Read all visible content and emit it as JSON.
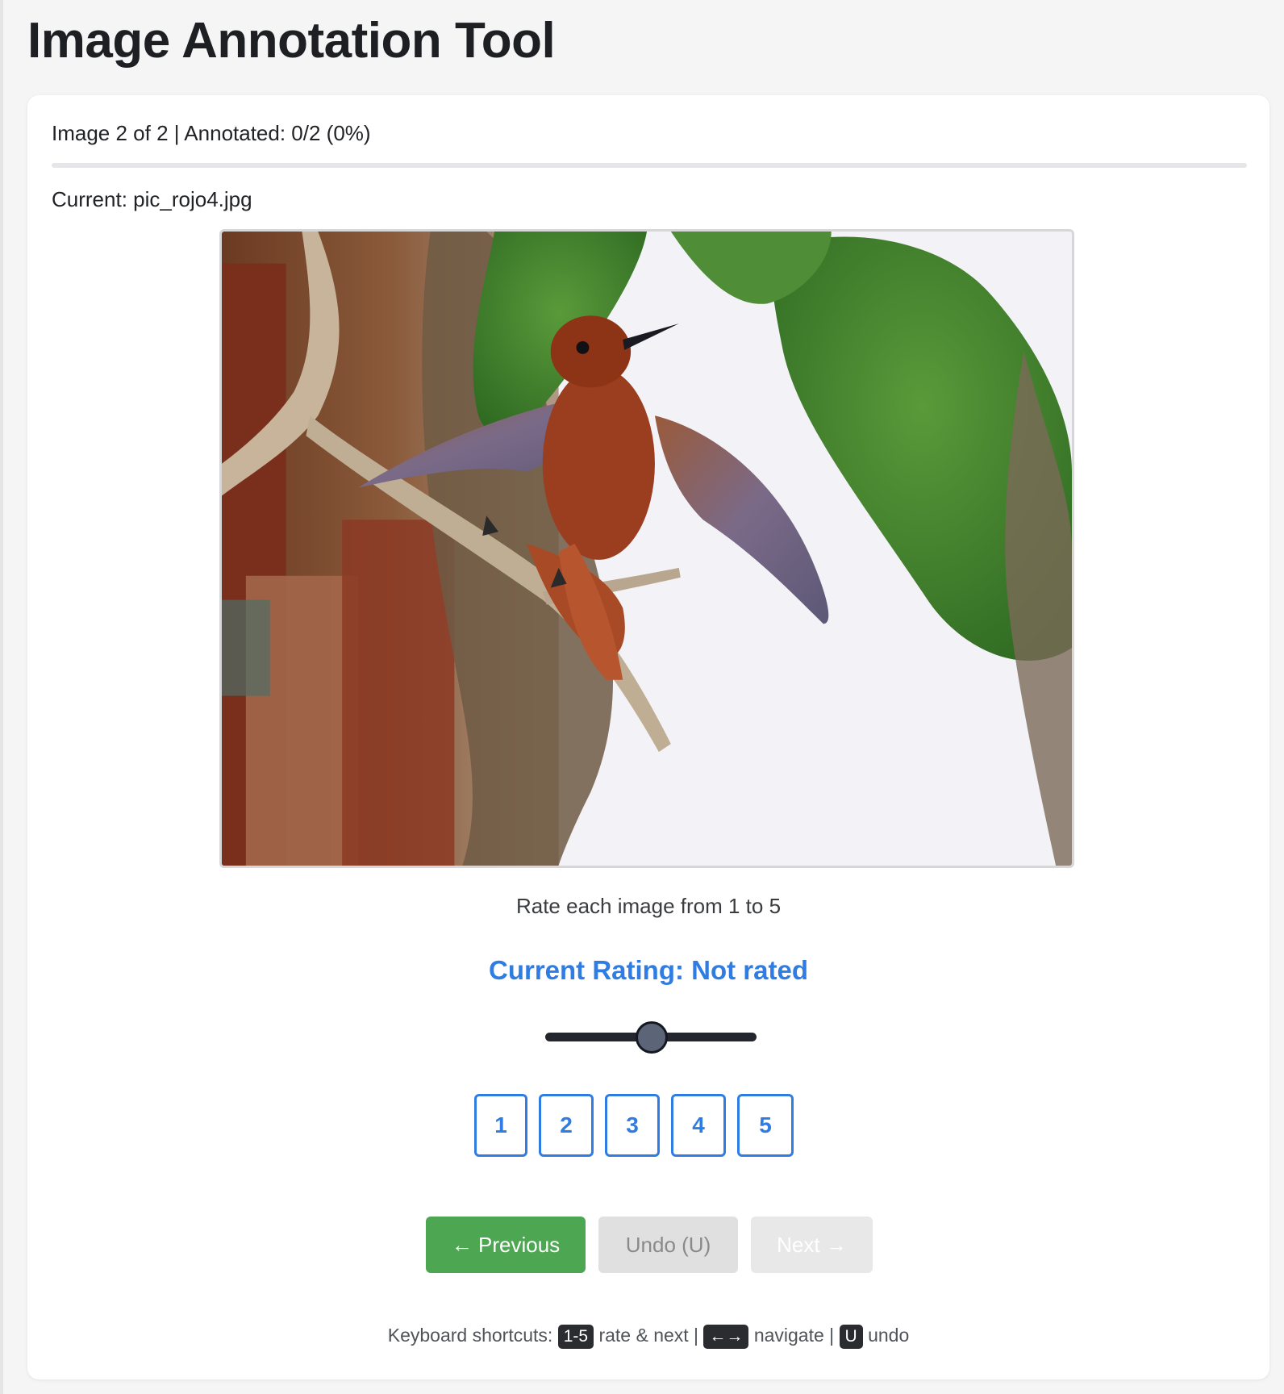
{
  "header": {
    "title": "Image Annotation Tool"
  },
  "status": {
    "progress_text": "Image 2 of 2 | Annotated: 0/2 (0%)",
    "progress_fraction": 0.0,
    "current_file": "Current: pic_rojo4.jpg"
  },
  "image": {
    "description_label": "hummingbird-photo"
  },
  "rating": {
    "instruction": "Rate each image from 1 to 5",
    "current": "Current Rating: Not rated",
    "slider_value": 3,
    "slider_min": 1,
    "slider_max": 5,
    "options": [
      "1",
      "2",
      "3",
      "4",
      "5"
    ]
  },
  "navigation": {
    "previous": "← Previous",
    "undo": "Undo (U)",
    "next": "Next →"
  },
  "shortcuts": {
    "prefix": "Keyboard shortcuts:",
    "key_rate": "1-5",
    "rate_text": "rate & next |",
    "key_nav": "←→",
    "nav_text": "navigate |",
    "key_undo": "U",
    "undo_text": "undo"
  },
  "colors": {
    "accent": "#2f7de3",
    "primary_button": "#4da752",
    "disabled_button": "#e0e0e0"
  }
}
